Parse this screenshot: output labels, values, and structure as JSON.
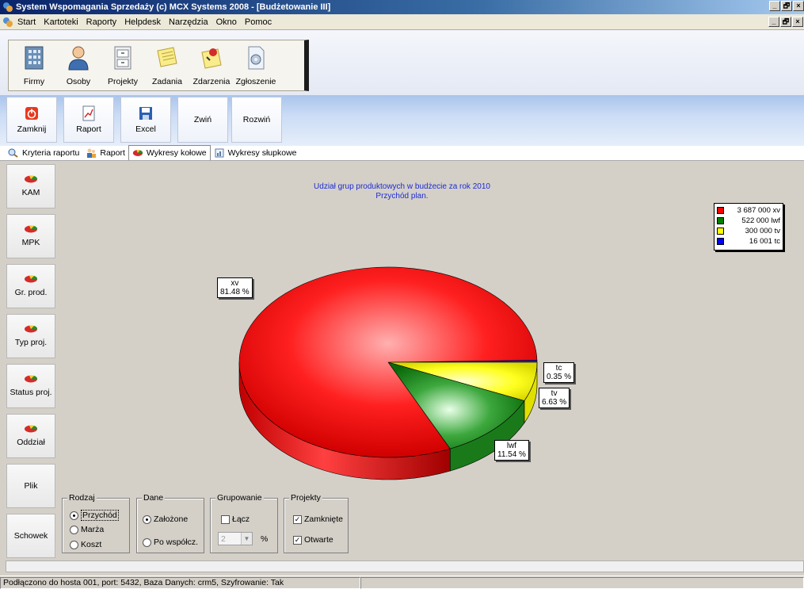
{
  "window": {
    "title": "System Wspomagania Sprzedaży (c) MCX Systems 2008 - [Budżetowanie III]",
    "min": "_",
    "restore": "🗗",
    "close": "×"
  },
  "menu": {
    "items": [
      "Start",
      "Kartoteki",
      "Raporty",
      "Helpdesk",
      "Narzędzia",
      "Okno",
      "Pomoc"
    ]
  },
  "toolbar1": {
    "buttons": [
      {
        "label": "Firmy",
        "icon": "building-icon"
      },
      {
        "label": "Osoby",
        "icon": "person-icon"
      },
      {
        "label": "Projekty",
        "icon": "cabinet-icon"
      },
      {
        "label": "Zadania",
        "icon": "notepad-icon"
      },
      {
        "label": "Zdarzenia",
        "icon": "pin-note-icon"
      },
      {
        "label": "Zgłoszenie",
        "icon": "gear-doc-icon"
      }
    ]
  },
  "toolbar2": {
    "buttons": [
      {
        "label": "Zamknij",
        "icon": "power-icon"
      },
      {
        "label": "Raport",
        "icon": "report-chart-icon"
      },
      {
        "label": "Excel",
        "icon": "floppy-icon"
      },
      {
        "label": "Zwiń",
        "icon": ""
      },
      {
        "label": "Rozwiń",
        "icon": ""
      }
    ]
  },
  "tabs": [
    {
      "label": "Kryteria raportu",
      "icon": "magnifier-icon",
      "active": false
    },
    {
      "label": "Raport",
      "icon": "people-icon",
      "active": false
    },
    {
      "label": "Wykresy kołowe",
      "icon": "pie-icon",
      "active": true
    },
    {
      "label": "Wykresy słupkowe",
      "icon": "bar-doc-icon",
      "active": false
    }
  ],
  "sidebar": {
    "items": [
      "KAM",
      "MPK",
      "Gr. prod.",
      "Typ proj.",
      "Status proj.",
      "Oddział",
      "Plik",
      "Schowek"
    ]
  },
  "chart_data": {
    "type": "pie",
    "title": "Udział grup produktowych w budżecie za rok 2010",
    "subtitle": "Przychód plan.",
    "slices": [
      {
        "name": "xv",
        "value": 3687000,
        "percent": 81.48,
        "color": "#ff0000"
      },
      {
        "name": "lwf",
        "value": 522000,
        "percent": 11.54,
        "color": "#008000"
      },
      {
        "name": "tv",
        "value": 300000,
        "percent": 6.63,
        "color": "#ffff00"
      },
      {
        "name": "tc",
        "value": 16001,
        "percent": 0.35,
        "color": "#0000ff"
      }
    ],
    "legend": [
      "3 687 000 xv",
      "522 000 lwf",
      "300 000 tv",
      "16 001 tc"
    ],
    "slice_labels": [
      "xv\n81.48 %",
      "lwf\n11.54 %",
      "tv\n6.63 %",
      "tc\n0.35 %"
    ],
    "legend_position": "top-right"
  },
  "options": {
    "rodzaj": {
      "title": "Rodzaj",
      "items": [
        "Przychód",
        "Marża",
        "Koszt"
      ],
      "selected": "Przychód"
    },
    "dane": {
      "title": "Dane",
      "items": [
        "Założone",
        "Po współcz."
      ],
      "selected": "Założone"
    },
    "grupowanie": {
      "title": "Grupowanie",
      "lacz_label": "Łącz",
      "lacz_checked": false,
      "value": "2",
      "unit": "%"
    },
    "projekty": {
      "title": "Projekty",
      "items": [
        {
          "label": "Zamknięte",
          "checked": true
        },
        {
          "label": "Otwarte",
          "checked": true
        }
      ]
    }
  },
  "status": {
    "text": "Podłączono do hosta 001, port: 5432, Baza Danych: crm5, Szyfrowanie: Tak"
  }
}
